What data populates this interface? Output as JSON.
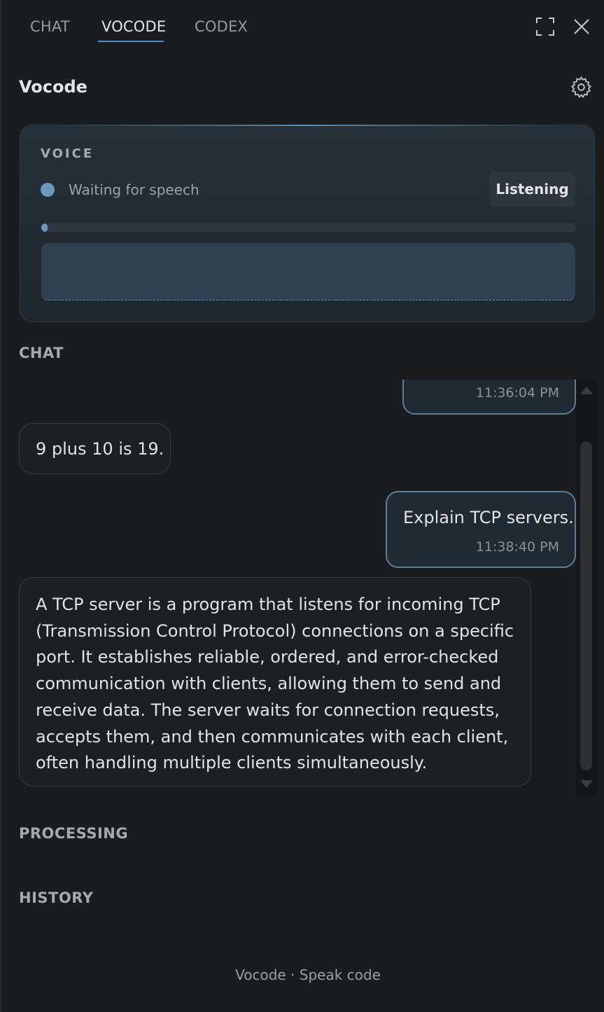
{
  "tabs": [
    {
      "label": "CHAT",
      "active": false
    },
    {
      "label": "VOCODE",
      "active": true
    },
    {
      "label": "CODEX",
      "active": false
    }
  ],
  "icons": {
    "maximize": "maximize-icon",
    "close": "close-icon",
    "settings": "gear-icon"
  },
  "colors": {
    "accent": "#4d8fd0",
    "status_dot": "#6c98bd",
    "user_bubble_border": "#5a7f9d"
  },
  "panel": {
    "title": "Vocode"
  },
  "voice": {
    "label": "VOICE",
    "status": "Waiting for speech",
    "button": "Listening",
    "level": 0.01,
    "transcript": ""
  },
  "sections": {
    "chat": "CHAT",
    "processing": "PROCESSING",
    "history": "HISTORY"
  },
  "chat": {
    "messages": [
      {
        "role": "user",
        "text": "",
        "time": "11:36:04 PM"
      },
      {
        "role": "assistant",
        "text": "9 plus 10 is 19."
      },
      {
        "role": "user",
        "text": "Explain TCP servers.",
        "time": "11:38:40 PM"
      },
      {
        "role": "assistant",
        "lines": [
          "A TCP server is a program that listens for incoming TCP",
          "(Transmission Control Protocol) connections on a specific",
          "port. It establishes reliable, ordered, and error-checked",
          "communication with clients, allowing them to send and",
          "receive data. The server waits for connection requests,",
          "accepts them, and then communicates with each client,",
          "often handling multiple clients simultaneously."
        ]
      }
    ]
  },
  "footer": "Vocode · Speak code"
}
